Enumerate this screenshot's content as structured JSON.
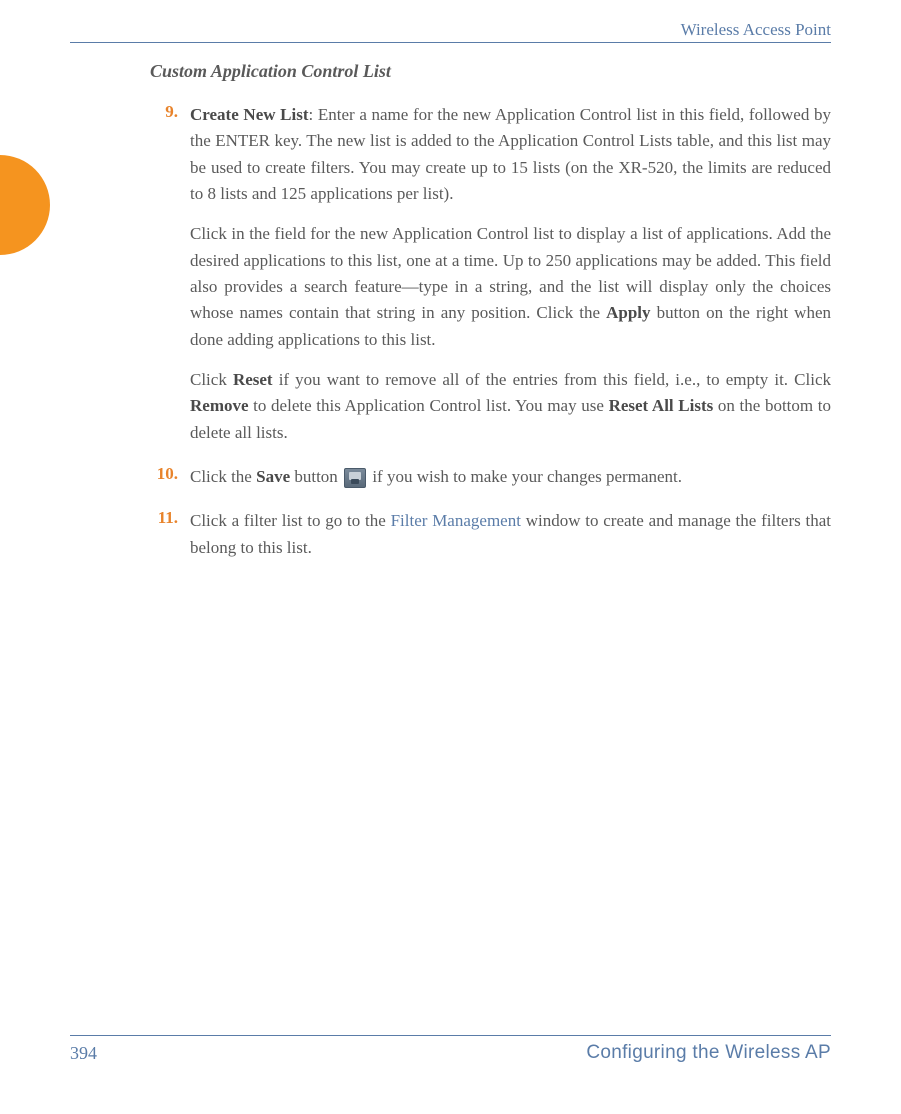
{
  "header": {
    "title": "Wireless Access Point"
  },
  "section": {
    "title": "Custom Application Control List"
  },
  "items": [
    {
      "number": "9.",
      "paragraphs": [
        {
          "segments": [
            {
              "bold": true,
              "text": "Create New List"
            },
            {
              "text": ": Enter a name for the new Application Control list in this field, followed by the ENTER key. The new list is added to the Application Control Lists table, and this list may be used to create filters. You may create up to 15 lists (on the XR-520, the limits are reduced to 8 lists and 125 applications per list)."
            }
          ]
        },
        {
          "segments": [
            {
              "text": "Click in the field for the new Application Control list to display a list of applications. Add the desired applications to this list, one at a time. Up to 250 applications may be added. This field also provides a search feature—type in a string, and the list will display only the choices whose names contain that string in any position. Click the "
            },
            {
              "bold": true,
              "text": "Apply"
            },
            {
              "text": " button on the right when done adding applications to this list."
            }
          ]
        },
        {
          "segments": [
            {
              "text": "Click "
            },
            {
              "bold": true,
              "text": "Reset"
            },
            {
              "text": " if you want to remove all of the entries from this field, i.e., to empty it. Click "
            },
            {
              "bold": true,
              "text": "Remove"
            },
            {
              "text": " to delete this Application Control list. You may use "
            },
            {
              "bold": true,
              "text": "Reset All Lists"
            },
            {
              "text": " on the bottom to delete all lists."
            }
          ]
        }
      ]
    },
    {
      "number": "10.",
      "paragraphs": [
        {
          "segments": [
            {
              "text": "Click the "
            },
            {
              "bold": true,
              "text": "Save"
            },
            {
              "text": " button "
            },
            {
              "icon": "save"
            },
            {
              "text": " if you wish to make your changes permanent."
            }
          ]
        }
      ]
    },
    {
      "number": "11.",
      "paragraphs": [
        {
          "segments": [
            {
              "text": "Click a filter list to go to the "
            },
            {
              "link": true,
              "text": "Filter Management"
            },
            {
              "text": " window to create and manage the filters that belong to this list."
            }
          ]
        }
      ]
    }
  ],
  "footer": {
    "page_number": "394",
    "section_name": "Configuring the Wireless AP"
  }
}
